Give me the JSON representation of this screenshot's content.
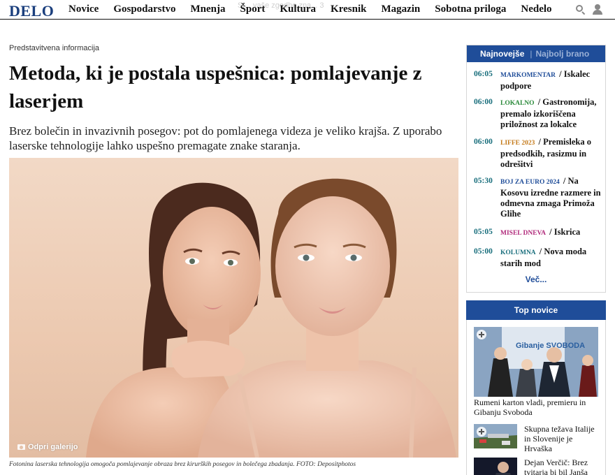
{
  "header": {
    "logo": "DELO",
    "nav": [
      "Novice",
      "Gospodarstvo",
      "Mnenja",
      "Šport",
      "Kultura",
      "Kresnik",
      "Magazin",
      "Sobotna priloga",
      "Nedelo"
    ],
    "ghost_text": "Sl... vaše zgodbe zna... 3",
    "icons": [
      "search-icon",
      "user-icon"
    ]
  },
  "article": {
    "label": "Predstavitvena informacija",
    "title": "Metoda, ki je postala uspešnica: pomlajevanje z laserjem",
    "lead": "Brez bolečin in invazivnih posegov: pot do pomlajenega videza je veliko krajša. Z uporabo laserske tehnologije lahko uspešno premagate znake staranja.",
    "gallery_label": "Odpri galerijo",
    "caption": "Fotonina laserska tehnologija omogoča pomlajevanje obraza brez kirurških posegov in bolečega zbadanja. FOTO: Depositphotos"
  },
  "sidebar": {
    "latest": {
      "tab_active": "Najnovejše",
      "tab_inactive": "Najbolj brano",
      "items": [
        {
          "time": "06:05",
          "category": "MARKOMENTAR",
          "cat_color": "#1f4d99",
          "title": "Iskalec podpore"
        },
        {
          "time": "06:00",
          "category": "LOKALNO",
          "cat_color": "#2a8a3a",
          "title": "Gastronomija, premalo izkoriščena priložnost za lokalce"
        },
        {
          "time": "06:00",
          "category": "LIFFE 2023",
          "cat_color": "#c47a1a",
          "title": "Premisleka o predsodkih, rasizmu in odrešitvi"
        },
        {
          "time": "05:30",
          "category": "BOJ ZA EURO 2024",
          "cat_color": "#1f4d99",
          "title": "Na Kosovu izredne razmere in odmevna zmaga Primoža Glihe"
        },
        {
          "time": "05:05",
          "category": "MISEL DNEVA",
          "cat_color": "#b0287a",
          "title": "Iskrica"
        },
        {
          "time": "05:00",
          "category": "KOLUMNA",
          "cat_color": "#1a6f7d",
          "title": "Nova moda starih mod"
        }
      ],
      "more": "Več..."
    },
    "top": {
      "header": "Top novice",
      "items": [
        {
          "title": "Rumeni karton vladi, premieru in Gibanju Svoboda"
        },
        {
          "title": "Skupna težava Italije in Slovenije je Hrvaška"
        },
        {
          "title": "Dejan Verčič: Brez tvitarja bi bil Janša"
        }
      ],
      "banner_text": "Gibanje SVOBODA"
    }
  }
}
